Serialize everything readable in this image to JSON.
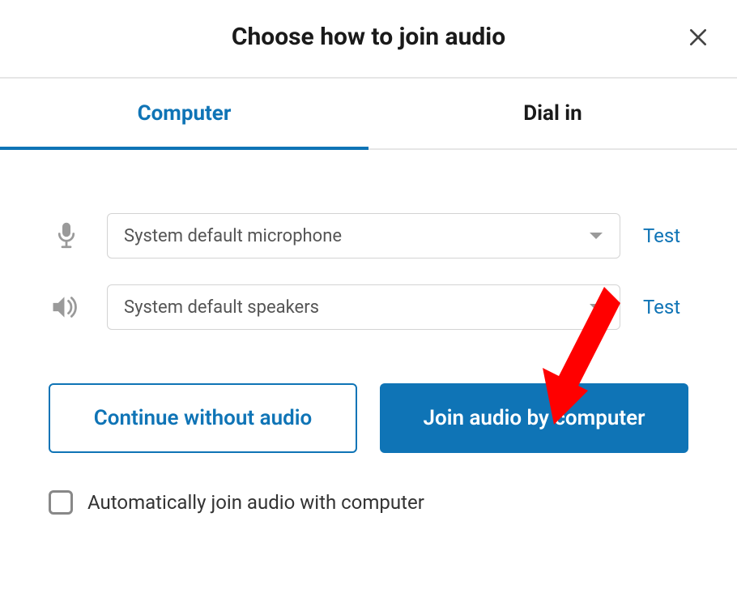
{
  "header": {
    "title": "Choose how to join audio"
  },
  "tabs": {
    "computer": "Computer",
    "dialin": "Dial in"
  },
  "audio": {
    "mic_selected": "System default microphone",
    "speaker_selected": "System default speakers",
    "test_label": "Test"
  },
  "buttons": {
    "continue_without": "Continue without audio",
    "join_by_computer": "Join audio by computer"
  },
  "checkbox": {
    "auto_join_label": "Automatically join audio with computer"
  }
}
